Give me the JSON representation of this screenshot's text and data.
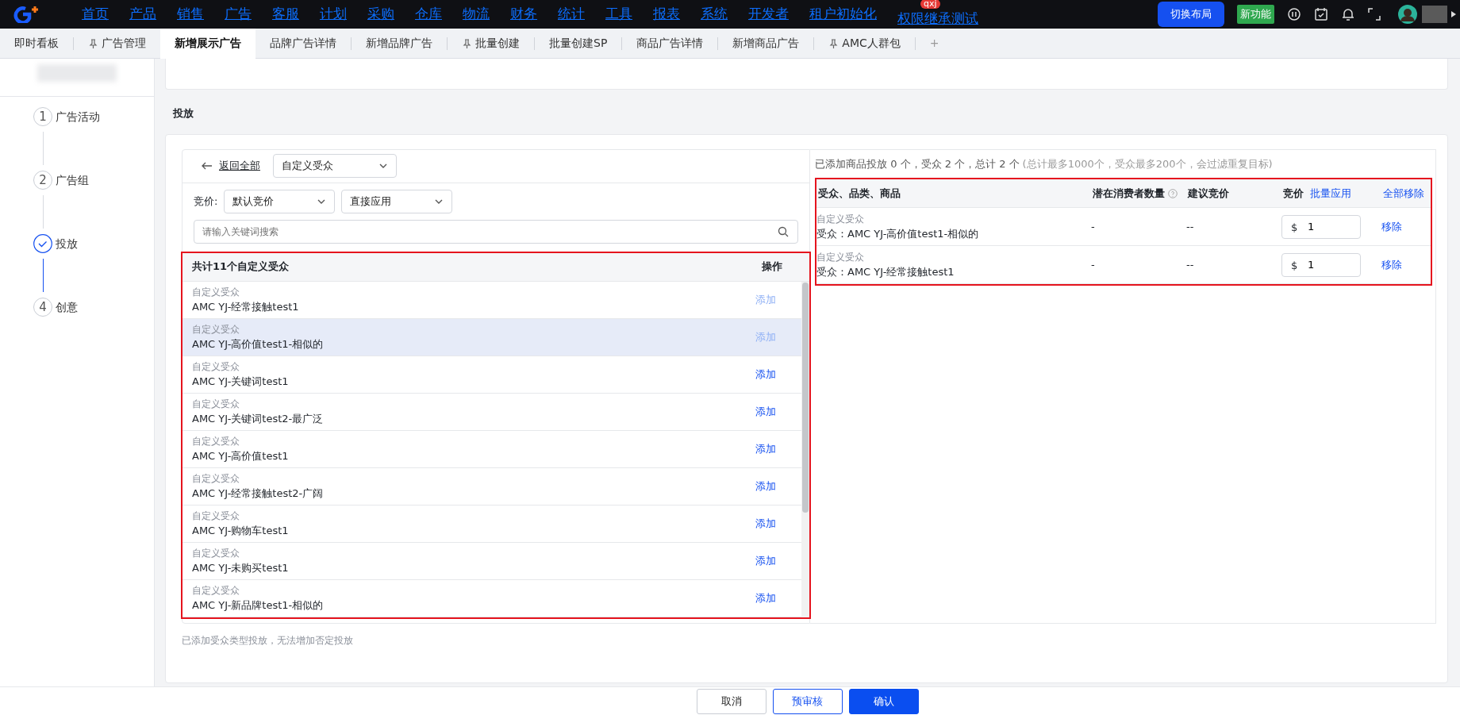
{
  "top_nav": {
    "items": [
      {
        "label": "首页"
      },
      {
        "label": "产品"
      },
      {
        "label": "销售"
      },
      {
        "label": "广告"
      },
      {
        "label": "客服"
      },
      {
        "label": "计划"
      },
      {
        "label": "采购"
      },
      {
        "label": "仓库"
      },
      {
        "label": "物流"
      },
      {
        "label": "财务"
      },
      {
        "label": "统计"
      },
      {
        "label": "工具"
      },
      {
        "label": "报表"
      },
      {
        "label": "系统"
      },
      {
        "label": "开发者"
      },
      {
        "label": "租户初始化"
      },
      {
        "label": "权限继承测试",
        "badge": "qxj"
      }
    ],
    "switch_layout_button": "切换布局",
    "new_feature_badge": "新功能"
  },
  "tabs": [
    {
      "label": "即时看板",
      "pinned": false,
      "selected": false
    },
    {
      "label": "广告管理",
      "pinned": true,
      "selected": false
    },
    {
      "label": "新增展示广告",
      "pinned": false,
      "selected": true
    },
    {
      "label": "品牌广告详情",
      "pinned": false,
      "selected": false
    },
    {
      "label": "新增品牌广告",
      "pinned": false,
      "selected": false
    },
    {
      "label": "批量创建",
      "pinned": true,
      "selected": false
    },
    {
      "label": "批量创建SP",
      "pinned": false,
      "selected": false
    },
    {
      "label": "商品广告详情",
      "pinned": false,
      "selected": false
    },
    {
      "label": "新增商品广告",
      "pinned": false,
      "selected": false
    },
    {
      "label": "AMC人群包",
      "pinned": true,
      "selected": false
    }
  ],
  "add_tab": "+",
  "steps": [
    {
      "number": "1",
      "label": "广告活动",
      "current": false
    },
    {
      "number": "2",
      "label": "广告组",
      "current": false
    },
    {
      "label": "投放",
      "current": true
    },
    {
      "number": "4",
      "label": "创意",
      "current": false
    }
  ],
  "section_title": "投放",
  "left_panel": {
    "back_link": "返回全部",
    "audience_select": "自定义受众",
    "bid_label": "竞价:",
    "bid_select": "默认竞价",
    "apply_select": "直接应用",
    "search": {
      "placeholder": "请输入关键词搜索"
    },
    "list_header": "共计11个自定义受众",
    "action_header": "操作",
    "rows": [
      {
        "type": "自定义受众",
        "name": "AMC YJ-经常接触test1",
        "action": "添加",
        "added": true,
        "selected": false
      },
      {
        "type": "自定义受众",
        "name": "AMC YJ-高价值test1-相似的",
        "action": "添加",
        "added": true,
        "selected": true
      },
      {
        "type": "自定义受众",
        "name": "AMC YJ-关键词test1",
        "action": "添加",
        "added": false,
        "selected": false
      },
      {
        "type": "自定义受众",
        "name": "AMC YJ-关键词test2-最广泛",
        "action": "添加",
        "added": false,
        "selected": false
      },
      {
        "type": "自定义受众",
        "name": "AMC YJ-高价值test1",
        "action": "添加",
        "added": false,
        "selected": false
      },
      {
        "type": "自定义受众",
        "name": "AMC YJ-经常接触test2-广阔",
        "action": "添加",
        "added": false,
        "selected": false
      },
      {
        "type": "自定义受众",
        "name": "AMC YJ-购物车test1",
        "action": "添加",
        "added": false,
        "selected": false
      },
      {
        "type": "自定义受众",
        "name": "AMC YJ-未购买test1",
        "action": "添加",
        "added": false,
        "selected": false
      },
      {
        "type": "自定义受众",
        "name": "AMC YJ-新品牌test1-相似的",
        "action": "添加",
        "added": false,
        "selected": false
      }
    ],
    "note": "已添加受众类型投放，无法增加否定投放"
  },
  "right_panel": {
    "summary": "已添加商品投放 0 个，受众 2 个，总计 2 个",
    "limit_note": "(总计最多1000个，受众最多200个，会过滤重复目标)",
    "columns": [
      "受众、品类、商品",
      "潜在消费者数量",
      "建议竞价",
      "竞价"
    ],
    "bulk_apply": "批量应用",
    "remove_all": "全部移除",
    "rows": [
      {
        "type": "自定义受众",
        "name": "受众：AMC YJ-高价值test1-相似的",
        "consumers": "-",
        "suggested_bid": "--",
        "currency": "$",
        "bid": "1",
        "action": "移除"
      },
      {
        "type": "自定义受众",
        "name": "受众：AMC YJ-经常接触test1",
        "consumers": "-",
        "suggested_bid": "--",
        "currency": "$",
        "bid": "1",
        "action": "移除"
      }
    ]
  },
  "footer_buttons": [
    {
      "label": "取消",
      "kind": "default"
    },
    {
      "label": "预审核",
      "kind": "outline"
    },
    {
      "label": "确认",
      "kind": "primary"
    }
  ]
}
